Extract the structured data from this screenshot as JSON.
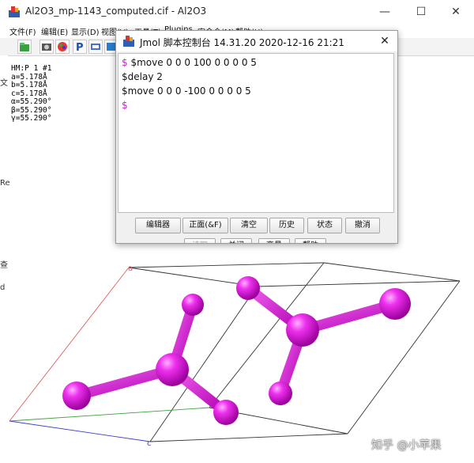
{
  "main_window": {
    "title": "Al2O3_mp-1143_computed.cif - Al2O3",
    "controls": {
      "minimize": "—",
      "maximize": "☐",
      "close": "✕"
    }
  },
  "menubar": {
    "items": [
      "文件(F)",
      "编辑(E)",
      "显示(D)",
      "视图(V)",
      "工具(T)",
      "Plugins",
      "宏命令(M)",
      "帮助(H)"
    ]
  },
  "toolbar": {
    "buttons": [
      "open-icon",
      "camera-icon",
      "palette-icon",
      "rotate-icon",
      "pick-icon",
      "export-icon"
    ]
  },
  "left_edge": {
    "chars": [
      "文",
      "Re",
      "查",
      "d"
    ]
  },
  "lattice_info": {
    "lines": [
      "HM:P 1 #1",
      "a=5.178Å",
      "b=5.178Å",
      "c=5.178Å",
      "α=55.290°",
      "β=55.290°",
      "γ=55.290°"
    ]
  },
  "axes_labels": {
    "a": "a",
    "c": "c"
  },
  "colors": {
    "atom": "#d81ad8",
    "bond": "#cc11cc",
    "prompt": "#e010e0",
    "axis_a": "#e06060",
    "axis_b": "#40a040",
    "axis_c": "#4040c0"
  },
  "console": {
    "title": "Jmol 脚本控制台 14.31.20  2020-12-16 21:21",
    "close": "✕",
    "prompt": "$",
    "lines": [
      {
        "prompt": "$",
        "text": " $move 0 0 0 100 0 0 0 0 5"
      },
      {
        "prompt": "",
        "text": "$delay 2"
      },
      {
        "prompt": "",
        "text": "$move 0 0 0 -100 0 0 0 0 5"
      },
      {
        "prompt": "$",
        "text": ""
      }
    ],
    "buttons": [
      "编辑器",
      "正面(&F)",
      "清空",
      "历史",
      "状态",
      "撤消"
    ],
    "buttons_row2": [
      "读取",
      "关闭",
      "变量",
      "帮助"
    ]
  },
  "watermark": "知乎 @小苹果"
}
